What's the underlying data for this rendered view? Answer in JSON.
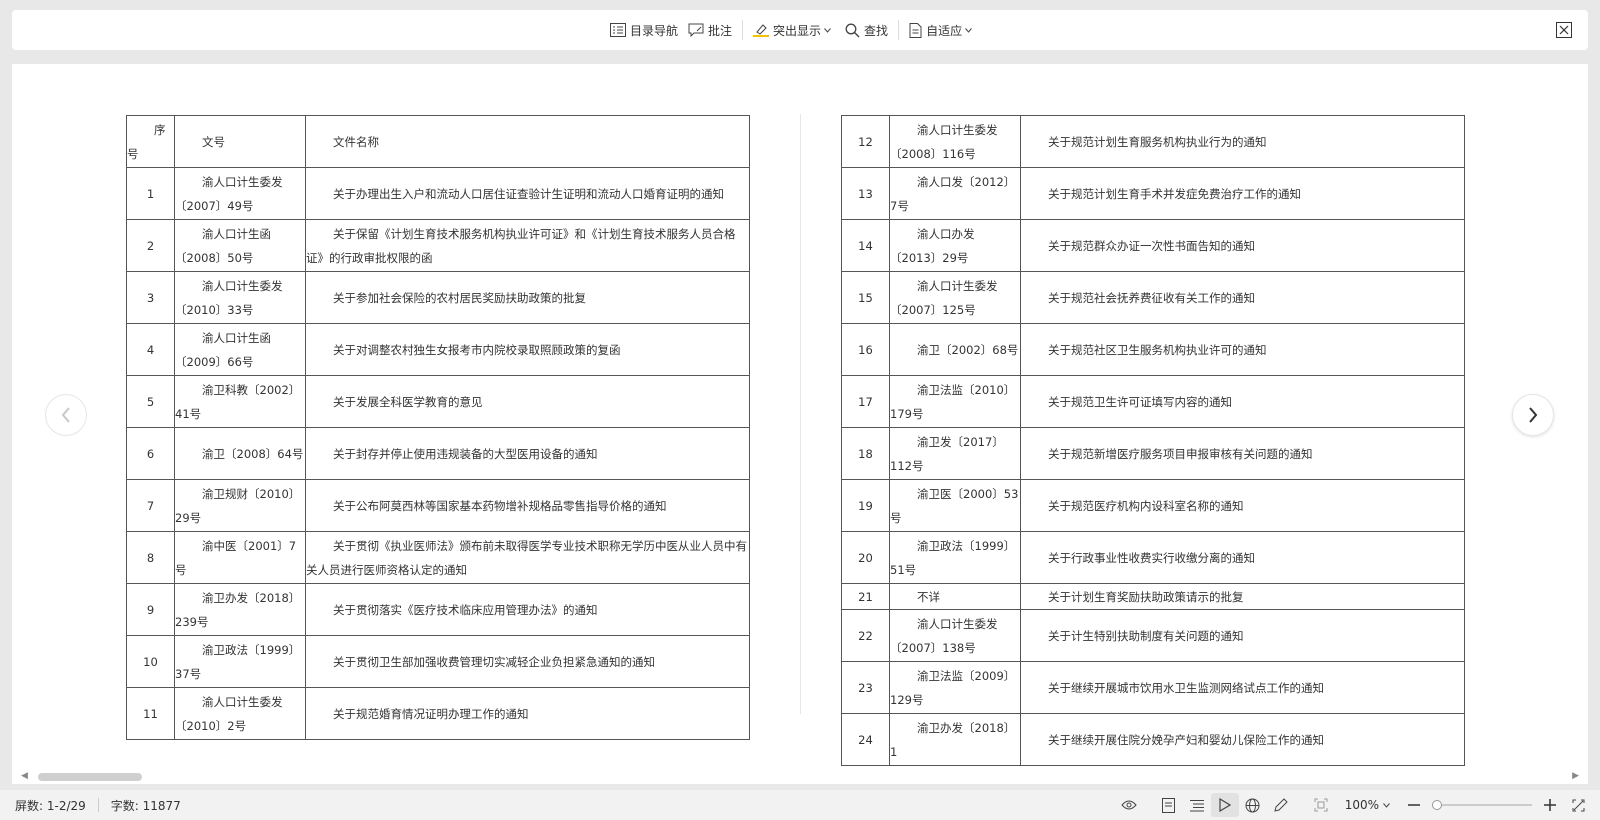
{
  "toolbar": {
    "toc_label": "目录导航",
    "comment_label": "批注",
    "highlight_label": "突出显示",
    "find_label": "查找",
    "fit_label": "自适应"
  },
  "table": {
    "headers": {
      "seq": "序号",
      "docno": "文号",
      "title": "文件名称"
    },
    "left_rows": [
      {
        "seq": "1",
        "docno": "渝人口计生委发〔2007〕49号",
        "title": "关于办理出生入户和流动人口居住证查验计生证明和流动人口婚育证明的通知"
      },
      {
        "seq": "2",
        "docno": "渝人口计生函〔2008〕50号",
        "title": "关于保留《计划生育技术服务机构执业许可证》和《计划生育技术服务人员合格证》的行政审批权限的函"
      },
      {
        "seq": "3",
        "docno": "渝人口计生委发〔2010〕33号",
        "title": "关于参加社会保险的农村居民奖励扶助政策的批复"
      },
      {
        "seq": "4",
        "docno": "渝人口计生函〔2009〕66号",
        "title": "关于对调整农村独生女报考市内院校录取照顾政策的复函"
      },
      {
        "seq": "5",
        "docno": "渝卫科教〔2002〕41号",
        "title": "关于发展全科医学教育的意见"
      },
      {
        "seq": "6",
        "docno": "渝卫〔2008〕64号",
        "title": "关于封存并停止使用违规装备的大型医用设备的通知"
      },
      {
        "seq": "7",
        "docno": "渝卫规财〔2010〕29号",
        "title": "关于公布阿莫西林等国家基本药物增补规格品零售指导价格的通知"
      },
      {
        "seq": "8",
        "docno": "渝中医〔2001〕7号",
        "title": "关于贯彻《执业医师法》颁布前未取得医学专业技术职称无学历中医从业人员中有关人员进行医师资格认定的通知"
      },
      {
        "seq": "9",
        "docno": "渝卫办发〔2018〕239号",
        "title": "关于贯彻落实《医疗技术临床应用管理办法》的通知"
      },
      {
        "seq": "10",
        "docno": "渝卫政法〔1999〕37号",
        "title": "关于贯彻卫生部加强收费管理切实减轻企业负担紧急通知的通知"
      },
      {
        "seq": "11",
        "docno": "渝人口计生委发〔2010〕2号",
        "title": "关于规范婚育情况证明办理工作的通知"
      }
    ],
    "right_rows": [
      {
        "seq": "12",
        "docno": "渝人口计生委发〔2008〕116号",
        "title": "关于规范计划生育服务机构执业行为的通知"
      },
      {
        "seq": "13",
        "docno": "渝人口发〔2012〕7号",
        "title": "关于规范计划生育手术并发症免费治疗工作的通知"
      },
      {
        "seq": "14",
        "docno": "渝人口办发〔2013〕29号",
        "title": "关于规范群众办证一次性书面告知的通知"
      },
      {
        "seq": "15",
        "docno": "渝人口计生委发〔2007〕125号",
        "title": "关于规范社会抚养费征收有关工作的通知"
      },
      {
        "seq": "16",
        "docno": "渝卫〔2002〕68号",
        "title": "关于规范社区卫生服务机构执业许可的通知"
      },
      {
        "seq": "17",
        "docno": "渝卫法监〔2010〕179号",
        "title": "关于规范卫生许可证填写内容的通知"
      },
      {
        "seq": "18",
        "docno": "渝卫发〔2017〕112号",
        "title": "关于规范新增医疗服务项目申报审核有关问题的通知"
      },
      {
        "seq": "19",
        "docno": "渝卫医〔2000〕53号",
        "title": "关于规范医疗机构内设科室名称的通知"
      },
      {
        "seq": "20",
        "docno": "渝卫政法〔1999〕51号",
        "title": "关于行政事业性收费实行收缴分离的通知"
      },
      {
        "seq": "21",
        "docno": "不详",
        "title": "关于计划生育奖励扶助政策请示的批复"
      },
      {
        "seq": "22",
        "docno": "渝人口计生委发〔2007〕138号",
        "title": "关于计生特别扶助制度有关问题的通知"
      },
      {
        "seq": "23",
        "docno": "渝卫法监〔2009〕129号",
        "title": "关于继续开展城市饮用水卫生监测网络试点工作的通知"
      },
      {
        "seq": "24",
        "docno": "渝卫办发〔2018〕1",
        "title": "关于继续开展住院分娩孕产妇和婴幼儿保险工作的通知"
      }
    ]
  },
  "status": {
    "pages": "屏数: 1-2/29",
    "words": "字数: 11877",
    "zoom": "100%",
    "zoom_fraction": 0
  }
}
